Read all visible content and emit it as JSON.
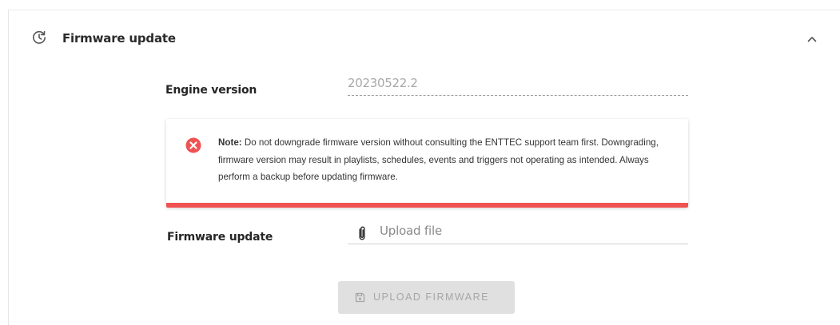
{
  "section": {
    "title": "Firmware update",
    "icon": "history-icon",
    "collapse_icon": "chevron-up-icon"
  },
  "engine": {
    "label": "Engine version",
    "value": "20230522.2"
  },
  "note": {
    "icon": "error-circle-icon",
    "prefix": "Note:",
    "text": " Do not downgrade firmware version without consulting the ENTTEC support team first. Downgrading, firmware version may result in playlists, schedules, events and triggers not operating as intended. Always perform a backup before updating firmware.",
    "accent_color": "#f05252"
  },
  "firmware": {
    "label": "Firmware update",
    "upload_placeholder": "Upload file",
    "upload_icon": "paperclip-icon"
  },
  "upload_button": {
    "label": "UPLOAD FIRMWARE",
    "icon": "save-icon",
    "state": "disabled"
  }
}
